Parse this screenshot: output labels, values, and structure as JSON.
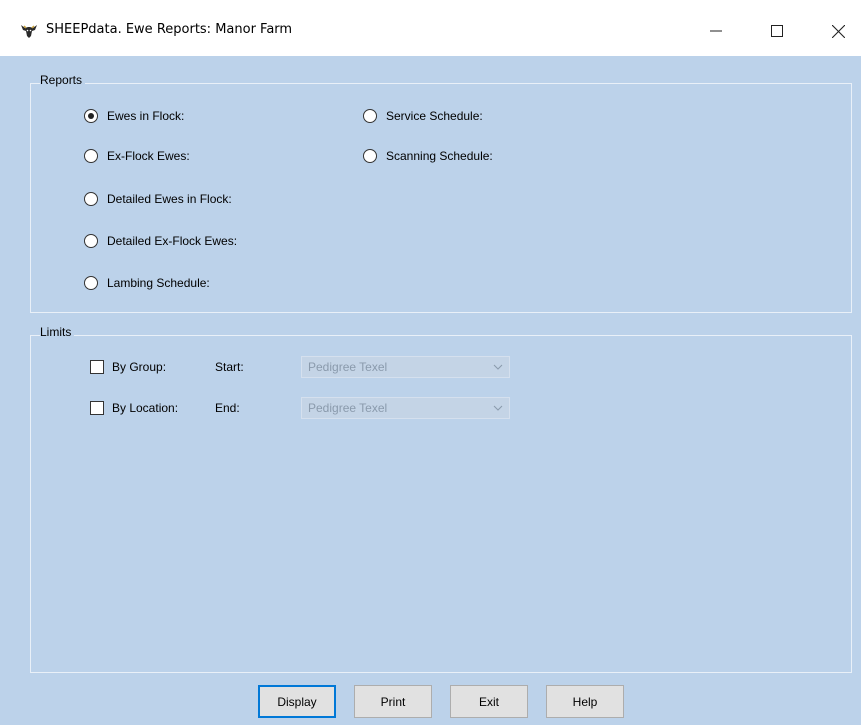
{
  "window": {
    "title": "SHEEPdata. Ewe Reports: Manor Farm",
    "icon": "sheep-icon",
    "controls": {
      "minimize": "minimize-icon",
      "maximize": "maximize-icon",
      "close": "close-icon"
    }
  },
  "reports": {
    "group_label": "Reports",
    "selected": "Ewes in Flock:",
    "options": [
      {
        "label": "Ewes in Flock:",
        "checked": true
      },
      {
        "label": "Ex-Flock Ewes:",
        "checked": false
      },
      {
        "label": "Detailed Ewes in Flock:",
        "checked": false
      },
      {
        "label": "Detailed Ex-Flock Ewes:",
        "checked": false
      },
      {
        "label": "Lambing Schedule:",
        "checked": false
      },
      {
        "label": "Service Schedule:",
        "checked": false
      },
      {
        "label": "Scanning Schedule:",
        "checked": false
      }
    ]
  },
  "limits": {
    "group_label": "Limits",
    "by_group": {
      "label": "By Group:",
      "checked": false
    },
    "by_location": {
      "label": "By Location:",
      "checked": false
    },
    "start_label": "Start:",
    "end_label": "End:",
    "start_value": "Pedigree Texel",
    "end_value": "Pedigree Texel"
  },
  "buttons": {
    "display": "Display",
    "print": "Print",
    "exit": "Exit",
    "help": "Help"
  },
  "colors": {
    "background": "#bcd2ea",
    "titlebar": "#ffffff",
    "focus_border": "#0078d7"
  }
}
